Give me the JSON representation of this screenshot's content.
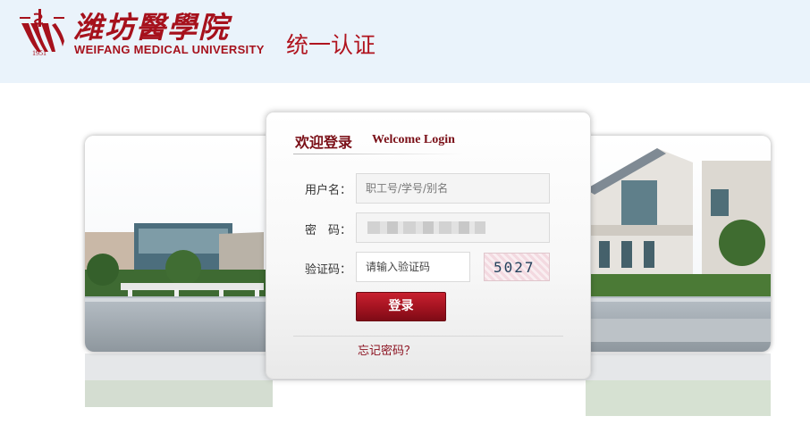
{
  "header": {
    "university_name_cn": "潍坊醫學院",
    "university_name_en": "WEIFANG MEDICAL UNIVERSITY",
    "founded_year": "1951",
    "portal_title": "统一认证",
    "logo_icon": "university-emblem-icon"
  },
  "login": {
    "welcome_cn": "欢迎登录",
    "welcome_en": "Welcome Login",
    "username_label": "用户名：",
    "username_placeholder": "职工号/学号/别名",
    "password_label": "密　码：",
    "captcha_label": "验证码：",
    "captcha_placeholder": "请输入验证码",
    "captcha_code": "5027",
    "submit_label": "登录",
    "forgot_label": "忘记密码？"
  },
  "colors": {
    "brand": "#a6111c",
    "header_bg": "#eaf3fb",
    "button": "#a21320"
  }
}
